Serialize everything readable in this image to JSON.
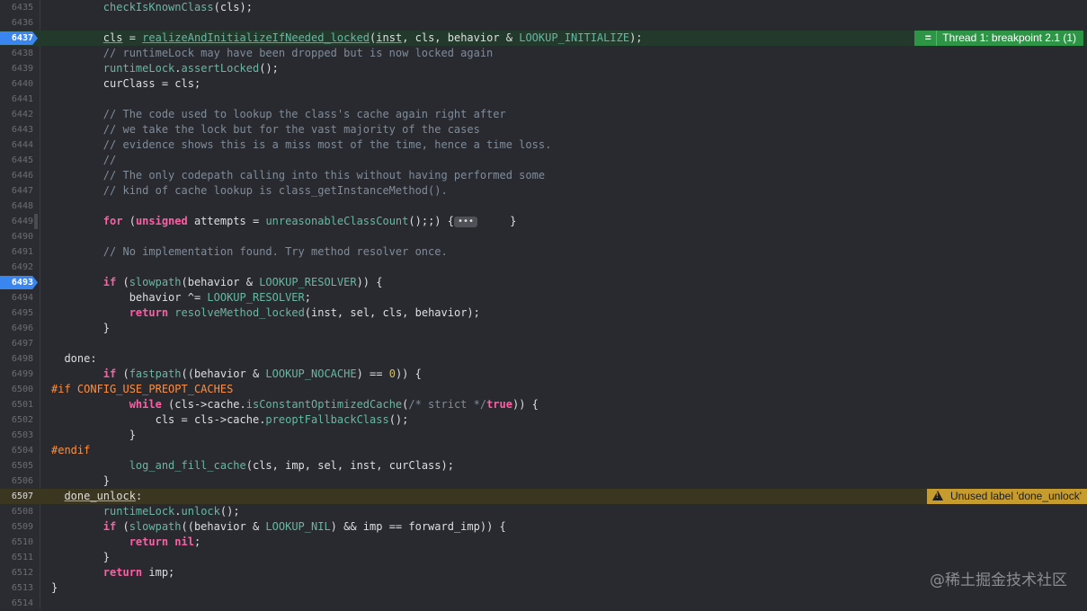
{
  "editor": {
    "thread_badge": "Thread 1: breakpoint 2.1 (1)",
    "warning_badge": "Unused label 'done_unlock'",
    "watermark": "@稀土掘金技术社区",
    "colors": {
      "background": "#292a30",
      "breakpoint": "#3a86f0",
      "thread_green": "#2e9547",
      "warning_yellow": "#c79c2f"
    },
    "lines": [
      {
        "n": "6435",
        "c": [
          [
            "",
            "        "
          ],
          [
            "fn",
            "checkIsKnownClass"
          ],
          [
            "",
            "(cls);"
          ]
        ]
      },
      {
        "n": "6436",
        "c": []
      },
      {
        "n": "6437",
        "bp": true,
        "hl": "green",
        "c": [
          [
            "",
            "        "
          ],
          [
            "ul",
            "cls"
          ],
          [
            "",
            " = "
          ],
          [
            "fn ul",
            "realizeAndInitializeIfNeeded_locked"
          ],
          [
            "",
            "("
          ],
          [
            "ul",
            "inst"
          ],
          [
            "",
            ", cls, behavior & "
          ],
          [
            "mc",
            "LOOKUP_INITIALIZE"
          ],
          [
            "",
            ");"
          ]
        ]
      },
      {
        "n": "6438",
        "c": [
          [
            "",
            "        "
          ],
          [
            "cm",
            "// runtimeLock may have been dropped but is now locked again"
          ]
        ]
      },
      {
        "n": "6439",
        "c": [
          [
            "",
            "        "
          ],
          [
            "fn",
            "runtimeLock"
          ],
          [
            "",
            "."
          ],
          [
            "fn",
            "assertLocked"
          ],
          [
            "",
            "();"
          ]
        ]
      },
      {
        "n": "6440",
        "c": [
          [
            "",
            "        curClass = cls;"
          ]
        ]
      },
      {
        "n": "6441",
        "c": []
      },
      {
        "n": "6442",
        "c": [
          [
            "",
            "        "
          ],
          [
            "cm",
            "// The code used to lookup the class's cache again right after"
          ]
        ]
      },
      {
        "n": "6443",
        "c": [
          [
            "",
            "        "
          ],
          [
            "cm",
            "// we take the lock but for the vast majority of the cases"
          ]
        ]
      },
      {
        "n": "6444",
        "c": [
          [
            "",
            "        "
          ],
          [
            "cm",
            "// evidence shows this is a miss most of the time, hence a time loss."
          ]
        ]
      },
      {
        "n": "6445",
        "c": [
          [
            "",
            "        "
          ],
          [
            "cm",
            "//"
          ]
        ]
      },
      {
        "n": "6446",
        "c": [
          [
            "",
            "        "
          ],
          [
            "cm",
            "// The only codepath calling into this without having performed some"
          ]
        ]
      },
      {
        "n": "6447",
        "c": [
          [
            "",
            "        "
          ],
          [
            "cm",
            "// kind of cache lookup is class_getInstanceMethod()."
          ]
        ]
      },
      {
        "n": "6448",
        "c": []
      },
      {
        "n": "6449",
        "fold": true,
        "c": [
          [
            "",
            "        "
          ],
          [
            "kw",
            "for"
          ],
          [
            "",
            " ("
          ],
          [
            "kw",
            "unsigned"
          ],
          [
            "",
            " attempts = "
          ],
          [
            "fn",
            "unreasonableClassCount"
          ],
          [
            "",
            "();;) {"
          ],
          [
            "pill",
            "•••"
          ],
          [
            "",
            "     }"
          ]
        ]
      },
      {
        "n": "6490",
        "c": []
      },
      {
        "n": "6491",
        "c": [
          [
            "",
            "        "
          ],
          [
            "cm",
            "// No implementation found. Try method resolver once."
          ]
        ]
      },
      {
        "n": "6492",
        "c": []
      },
      {
        "n": "6493",
        "bp": true,
        "c": [
          [
            "",
            "        "
          ],
          [
            "kw",
            "if"
          ],
          [
            "",
            " ("
          ],
          [
            "fn",
            "slowpath"
          ],
          [
            "",
            "(behavior & "
          ],
          [
            "mc",
            "LOOKUP_RESOLVER"
          ],
          [
            "",
            ")) {"
          ]
        ]
      },
      {
        "n": "6494",
        "c": [
          [
            "",
            "            behavior ^= "
          ],
          [
            "mc",
            "LOOKUP_RESOLVER"
          ],
          [
            "",
            ";"
          ]
        ]
      },
      {
        "n": "6495",
        "c": [
          [
            "",
            "            "
          ],
          [
            "kw",
            "return"
          ],
          [
            "",
            " "
          ],
          [
            "fn",
            "resolveMethod_locked"
          ],
          [
            "",
            "(inst, sel, cls, behavior);"
          ]
        ]
      },
      {
        "n": "6496",
        "c": [
          [
            "",
            "        }"
          ]
        ]
      },
      {
        "n": "6497",
        "c": []
      },
      {
        "n": "6498",
        "c": [
          [
            "",
            "  done:"
          ]
        ]
      },
      {
        "n": "6499",
        "c": [
          [
            "",
            "        "
          ],
          [
            "kw",
            "if"
          ],
          [
            "",
            " ("
          ],
          [
            "fn",
            "fastpath"
          ],
          [
            "",
            "((behavior & "
          ],
          [
            "mc",
            "LOOKUP_NOCACHE"
          ],
          [
            "",
            ") == "
          ],
          [
            "num",
            "0"
          ],
          [
            "",
            ")) {"
          ]
        ]
      },
      {
        "n": "6500",
        "c": [
          [
            "pp",
            "#if CONFIG_USE_PREOPT_CACHES"
          ]
        ]
      },
      {
        "n": "6501",
        "c": [
          [
            "",
            "            "
          ],
          [
            "kw",
            "while"
          ],
          [
            "",
            " (cls->cache."
          ],
          [
            "fn",
            "isConstantOptimizedCache"
          ],
          [
            "",
            "("
          ],
          [
            "cm",
            "/* strict */"
          ],
          [
            "kw",
            "true"
          ],
          [
            "",
            ")) {"
          ]
        ]
      },
      {
        "n": "6502",
        "c": [
          [
            "",
            "                cls = cls->cache."
          ],
          [
            "fn",
            "preoptFallbackClass"
          ],
          [
            "",
            "();"
          ]
        ]
      },
      {
        "n": "6503",
        "c": [
          [
            "",
            "            }"
          ]
        ]
      },
      {
        "n": "6504",
        "c": [
          [
            "pp",
            "#endif"
          ]
        ]
      },
      {
        "n": "6505",
        "c": [
          [
            "",
            "            "
          ],
          [
            "fn",
            "log_and_fill_cache"
          ],
          [
            "",
            "(cls, imp, sel, inst, curClass);"
          ]
        ]
      },
      {
        "n": "6506",
        "c": [
          [
            "",
            "        }"
          ]
        ]
      },
      {
        "n": "6507",
        "cur": true,
        "hl": "yellow",
        "c": [
          [
            "",
            "  "
          ],
          [
            "uly",
            "done_unlock"
          ],
          [
            "",
            ":"
          ]
        ]
      },
      {
        "n": "6508",
        "c": [
          [
            "",
            "        "
          ],
          [
            "fn",
            "runtimeLock"
          ],
          [
            "",
            "."
          ],
          [
            "fn",
            "unlock"
          ],
          [
            "",
            "();"
          ]
        ]
      },
      {
        "n": "6509",
        "c": [
          [
            "",
            "        "
          ],
          [
            "kw",
            "if"
          ],
          [
            "",
            " ("
          ],
          [
            "fn",
            "slowpath"
          ],
          [
            "",
            "((behavior & "
          ],
          [
            "mc",
            "LOOKUP_NIL"
          ],
          [
            "",
            ") && imp == forward_imp)) {"
          ]
        ]
      },
      {
        "n": "6510",
        "c": [
          [
            "",
            "            "
          ],
          [
            "kw",
            "return"
          ],
          [
            "",
            " "
          ],
          [
            "kw",
            "nil"
          ],
          [
            "",
            ";"
          ]
        ]
      },
      {
        "n": "6511",
        "c": [
          [
            "",
            "        }"
          ]
        ]
      },
      {
        "n": "6512",
        "c": [
          [
            "",
            "        "
          ],
          [
            "kw",
            "return"
          ],
          [
            "",
            " imp;"
          ]
        ]
      },
      {
        "n": "6513",
        "c": [
          [
            "",
            "}"
          ]
        ]
      },
      {
        "n": "6514",
        "c": []
      }
    ]
  }
}
